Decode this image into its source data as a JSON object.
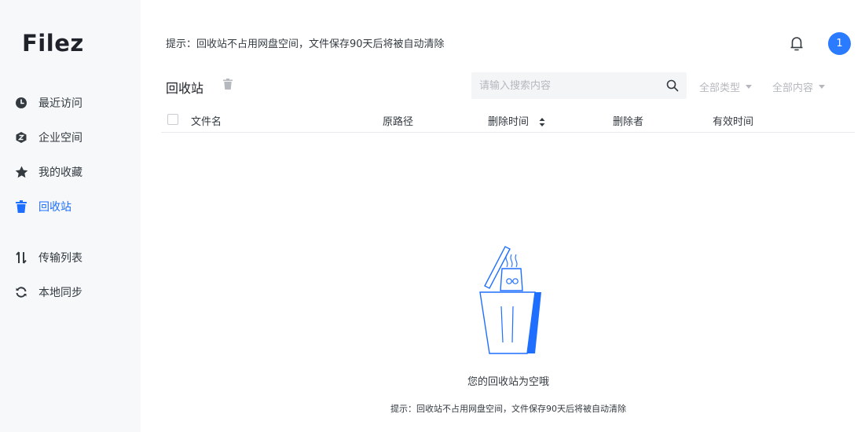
{
  "app": {
    "logo": "Filez"
  },
  "sidebar": {
    "items": [
      {
        "label": "最近访问",
        "icon": "clock-icon"
      },
      {
        "label": "企业空间",
        "icon": "enterprise-space-icon"
      },
      {
        "label": "我的收藏",
        "icon": "star-icon"
      },
      {
        "label": "回收站",
        "icon": "trash-icon",
        "active": true
      },
      {
        "label": "传输列表",
        "icon": "transfer-icon"
      },
      {
        "label": "本地同步",
        "icon": "sync-icon"
      }
    ]
  },
  "header": {
    "tip": "提示：回收站不占用网盘空间，文件保存90天后将被自动清除",
    "notification_count": "1"
  },
  "toolbar": {
    "title": "回收站",
    "search_placeholder": "请输入搜索内容",
    "filter_type": "全部类型",
    "filter_content": "全部内容"
  },
  "table": {
    "columns": [
      "文件名",
      "原路径",
      "删除时间",
      "删除者",
      "有效时间"
    ]
  },
  "empty_state": {
    "title": "您的回收站为空哦",
    "tip": "提示：回收站不占用网盘空间，文件保存90天后将被自动清除"
  },
  "colors": {
    "accent": "#1e6fff",
    "badge": "#2a7bff",
    "sidebar_bg": "#f7f8fa"
  }
}
